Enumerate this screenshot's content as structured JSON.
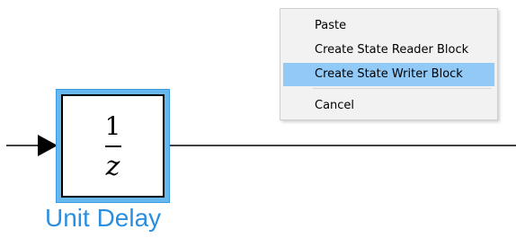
{
  "block": {
    "numerator": "1",
    "denominator": "z",
    "label": "Unit Delay",
    "selected": true
  },
  "context_menu": {
    "items": [
      {
        "label": "Paste",
        "highlighted": false
      },
      {
        "label": "Create State Reader Block",
        "highlighted": false
      },
      {
        "label": "Create State Writer Block",
        "highlighted": true
      },
      {
        "label": "Cancel",
        "highlighted": false
      }
    ]
  },
  "colors": {
    "selection_fill": "#66b8ee",
    "label_blue": "#2a8fe0",
    "menu_highlight": "#91c9f7",
    "menu_background": "#f2f2f2",
    "signal_line": "#000000"
  }
}
